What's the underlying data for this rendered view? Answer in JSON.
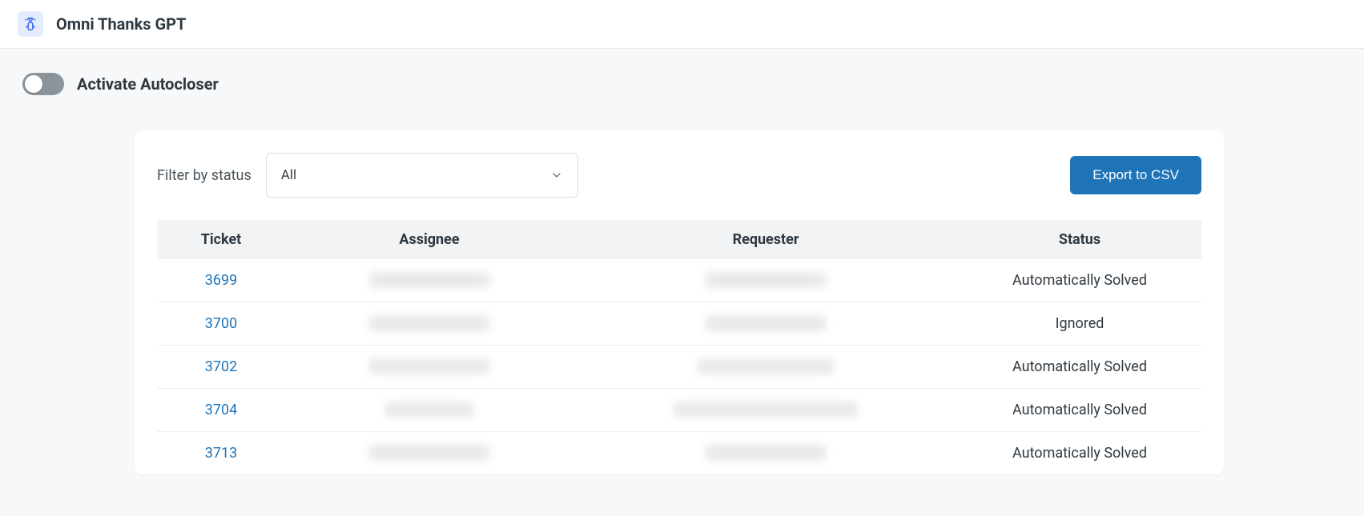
{
  "header": {
    "title": "Omni Thanks GPT",
    "icon": "robot-thanks-icon"
  },
  "toggle": {
    "label": "Activate Autocloser",
    "state": "off"
  },
  "filter": {
    "label": "Filter by status",
    "selected": "All"
  },
  "actions": {
    "export_label": "Export to CSV"
  },
  "table": {
    "headers": {
      "ticket": "Ticket",
      "assignee": "Assignee",
      "requester": "Requester",
      "status": "Status"
    },
    "rows": [
      {
        "ticket": "3699",
        "assignee_w": 150,
        "requester_w": 150,
        "status": "Automatically Solved"
      },
      {
        "ticket": "3700",
        "assignee_w": 150,
        "requester_w": 150,
        "status": "Ignored"
      },
      {
        "ticket": "3702",
        "assignee_w": 150,
        "requester_w": 170,
        "status": "Automatically Solved"
      },
      {
        "ticket": "3704",
        "assignee_w": 110,
        "requester_w": 230,
        "status": "Automatically Solved"
      },
      {
        "ticket": "3713",
        "assignee_w": 150,
        "requester_w": 150,
        "status": "Automatically Solved"
      }
    ]
  }
}
